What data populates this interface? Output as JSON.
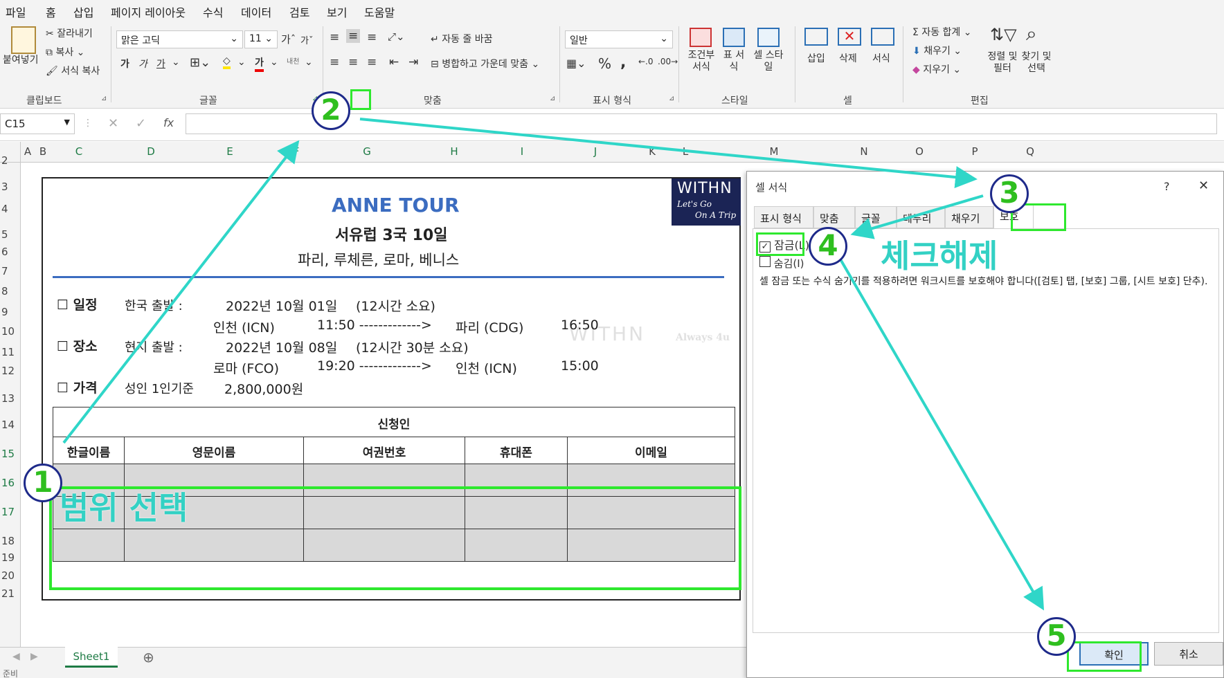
{
  "menu": [
    "파일",
    "홈",
    "삽입",
    "페이지 레이아웃",
    "수식",
    "데이터",
    "검토",
    "보기",
    "도움말"
  ],
  "ribbon": {
    "clipboard": {
      "paste": "붙여넣기",
      "cut": "잘라내기",
      "copy": "복사",
      "format_painter": "서식 복사",
      "label": "클립보드"
    },
    "font": {
      "name": "맑은 고딕",
      "size": "11",
      "label": "글꼴",
      "bold": "가",
      "italic": "가",
      "underline": "가",
      "font_color_glyph": "가",
      "phonetic": "내천"
    },
    "alignment": {
      "wrap": "자동 줄 바꿈",
      "merge": "병합하고 가운데 맞춤",
      "label": "맞춤"
    },
    "number": {
      "format": "일반",
      "label": "표시 형식",
      "percent": "%",
      "comma": ","
    },
    "styles": {
      "conditional": "조건부 서식",
      "table": "표 서식",
      "cell": "셀 스타일",
      "label": "스타일"
    },
    "cells": {
      "insert": "삽입",
      "delete": "삭제",
      "format": "서식",
      "label": "셀"
    },
    "editing": {
      "autosum": "자동 합계",
      "fill": "채우기",
      "clear": "지우기",
      "sort": "정렬 및 필터",
      "find": "찾기 및 선택",
      "label": "편집"
    }
  },
  "formula_bar": {
    "name_box": "C15",
    "fx": "fx",
    "value": ""
  },
  "columns": [
    "A",
    "B",
    "C",
    "D",
    "E",
    "F",
    "G",
    "H",
    "I",
    "J",
    "K",
    "L",
    "M",
    "N",
    "O",
    "P",
    "Q"
  ],
  "rows": [
    "2",
    "3",
    "4",
    "5",
    "6",
    "7",
    "8",
    "9",
    "10",
    "11",
    "12",
    "13",
    "14",
    "15",
    "16",
    "17",
    "18",
    "19",
    "20",
    "21"
  ],
  "doc": {
    "title": "ANNE TOUR",
    "subtitle": "서유럽 3국 10일",
    "cities": "파리, 루체른, 로마, 베니스",
    "logo": {
      "text": "WITHN",
      "tagline1": "Let's Go",
      "tagline2": "On A Trip"
    },
    "watermark": "WITHN",
    "watermark_small": "Always 4u",
    "schedule_label": "☐ 일정",
    "schedule_line1": {
      "a": "한국 출발 :",
      "b": "2022년 10월 01일",
      "c": "(12시간 소요)"
    },
    "schedule_line2": {
      "a": "인천 (ICN)",
      "b": "11:50 ------------->",
      "c": "파리 (CDG)",
      "d": "16:50"
    },
    "place_label": "☐ 장소",
    "place_line1": {
      "a": "현지 출발 :",
      "b": "2022년 10월 08일",
      "c": "(12시간 30분 소요)"
    },
    "place_line2": {
      "a": "로마 (FCO)",
      "b": "19:20 ------------->",
      "c": "인천 (ICN)",
      "d": "15:00"
    },
    "price_label": "☐ 가격",
    "price_line": {
      "a": "성인 1인기준",
      "b": "2,800,000원"
    },
    "table_title": "신청인",
    "table_headers": [
      "한글이름",
      "영문이름",
      "여권번호",
      "휴대폰",
      "이메일"
    ]
  },
  "sheet_tab": "Sheet1",
  "status": "준비",
  "dialog": {
    "title": "셀 서식",
    "help": "?",
    "close": "✕",
    "tabs": [
      "표시 형식",
      "맞춤",
      "글꼴",
      "테두리",
      "채우기",
      "보호"
    ],
    "locked_label": "잠금(L)",
    "locked_checked": true,
    "hidden_label": "숨김(I)",
    "hidden_checked": false,
    "note": "셀 잠금 또는 수식 숨기기를 적용하려면 워크시트를 보호해야 합니다([검토] 탭, [보호] 그룹, [시트 보호] 단추).",
    "ok": "확인",
    "cancel": "취소"
  },
  "annotations": {
    "steps": [
      "1",
      "2",
      "3",
      "4",
      "5"
    ],
    "range_select": "범위 선택",
    "uncheck": "체크해제",
    "circle_color": "#1e2a8a",
    "number_color": "#2fbf1f",
    "arrow_color": "#2fd6c8",
    "box_color": "#2ee82e"
  }
}
